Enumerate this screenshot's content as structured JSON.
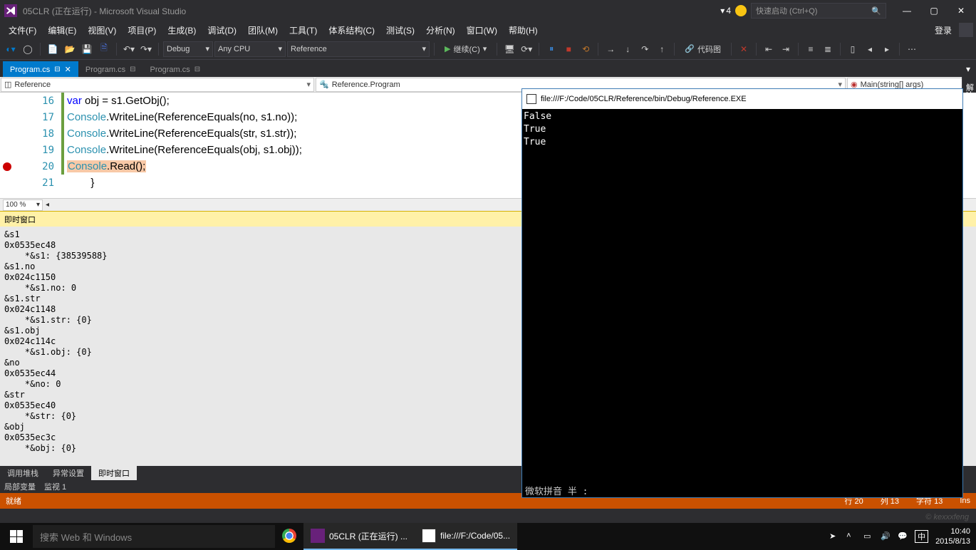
{
  "title": "05CLR (正在运行) - Microsoft Visual Studio",
  "notif_count": "4",
  "quick_launch_placeholder": "快速启动 (Ctrl+Q)",
  "menus": [
    "文件(F)",
    "编辑(E)",
    "视图(V)",
    "项目(P)",
    "生成(B)",
    "调试(D)",
    "团队(M)",
    "工具(T)",
    "体系结构(C)",
    "测试(S)",
    "分析(N)",
    "窗口(W)",
    "帮助(H)"
  ],
  "login": "登录",
  "toolbar": {
    "config": "Debug",
    "platform": "Any CPU",
    "project": "Reference",
    "continue": "继续(C)",
    "codemap": "代码图"
  },
  "tabs": [
    {
      "label": "Program.cs",
      "active": true
    },
    {
      "label": "Program.cs",
      "active": false
    },
    {
      "label": "Program.cs",
      "active": false
    }
  ],
  "side_vert": "解决",
  "nav": {
    "left": "Reference",
    "mid": "Reference.Program",
    "right": "Main(string[] args)"
  },
  "code": {
    "lines": [
      {
        "n": "16",
        "changed": true,
        "bp": false,
        "html": "<span class='kw'>var</span> obj = s1.GetObj();"
      },
      {
        "n": "17",
        "changed": true,
        "bp": false,
        "html": "<span class='type'>Console</span>.WriteLine(ReferenceEquals(no, s1.no));"
      },
      {
        "n": "18",
        "changed": true,
        "bp": false,
        "html": "<span class='type'>Console</span>.WriteLine(ReferenceEquals(str, s1.str));"
      },
      {
        "n": "19",
        "changed": true,
        "bp": false,
        "html": "<span class='type'>Console</span>.WriteLine(ReferenceEquals(obj, s1.obj));"
      },
      {
        "n": "20",
        "changed": true,
        "bp": true,
        "html": "<span class='hl-stmt'><span class='type'>Console</span>.Read();</span>"
      },
      {
        "n": "21",
        "changed": false,
        "bp": false,
        "html": "}"
      }
    ],
    "indent": "            "
  },
  "zoom": "100 %",
  "immediate": {
    "title": "即时窗口",
    "content": "&s1\n0x0535ec48\n    *&s1: {38539588}\n&s1.no\n0x024c1150\n    *&s1.no: 0\n&s1.str\n0x024c1148\n    *&s1.str: {0}\n&s1.obj\n0x024c114c\n    *&s1.obj: {0}\n&no\n0x0535ec44\n    *&no: 0\n&str\n0x0535ec40\n    *&str: {0}\n&obj\n0x0535ec3c\n    *&obj: {0}"
  },
  "bottom_tabs": [
    "调用堆栈",
    "异常设置",
    "即时窗口"
  ],
  "bottom_panels": [
    "局部变量",
    "监视 1"
  ],
  "status": {
    "ready": "就绪",
    "line": "行 20",
    "col": "列 13",
    "char": "字符 13",
    "ins": "Ins"
  },
  "console": {
    "title": "file:///F:/Code/05CLR/Reference/bin/Debug/Reference.EXE",
    "output": "False\nTrue\nTrue",
    "ime": "微软拼音 半 :"
  },
  "taskbar": {
    "search_placeholder": "搜索 Web 和 Windows",
    "apps": [
      {
        "name": "chrome",
        "label": "",
        "cls": "chrome-ic"
      },
      {
        "name": "vs",
        "label": "05CLR (正在运行) ...",
        "cls": "vs-ic",
        "active": true
      },
      {
        "name": "console",
        "label": "file:///F:/Code/05...",
        "cls": "con-ic",
        "active": true
      }
    ],
    "ime_label": "中",
    "time": "10:40",
    "date": "2015/8/13"
  },
  "watermark": "© kexxxfeng"
}
